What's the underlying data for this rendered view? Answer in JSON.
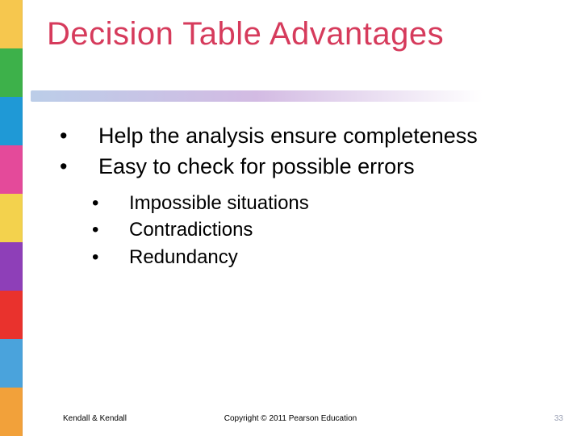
{
  "title": "Decision Table Advantages",
  "bullets": {
    "b1": "Help the analysis ensure completeness",
    "b2": "Easy to check for possible errors",
    "sub1": "Impossible situations",
    "sub2": "Contradictions",
    "sub3": "Redundancy"
  },
  "footer": {
    "left": "Kendall & Kendall",
    "center": "Copyright © 2011 Pearson Education",
    "right": "33"
  }
}
